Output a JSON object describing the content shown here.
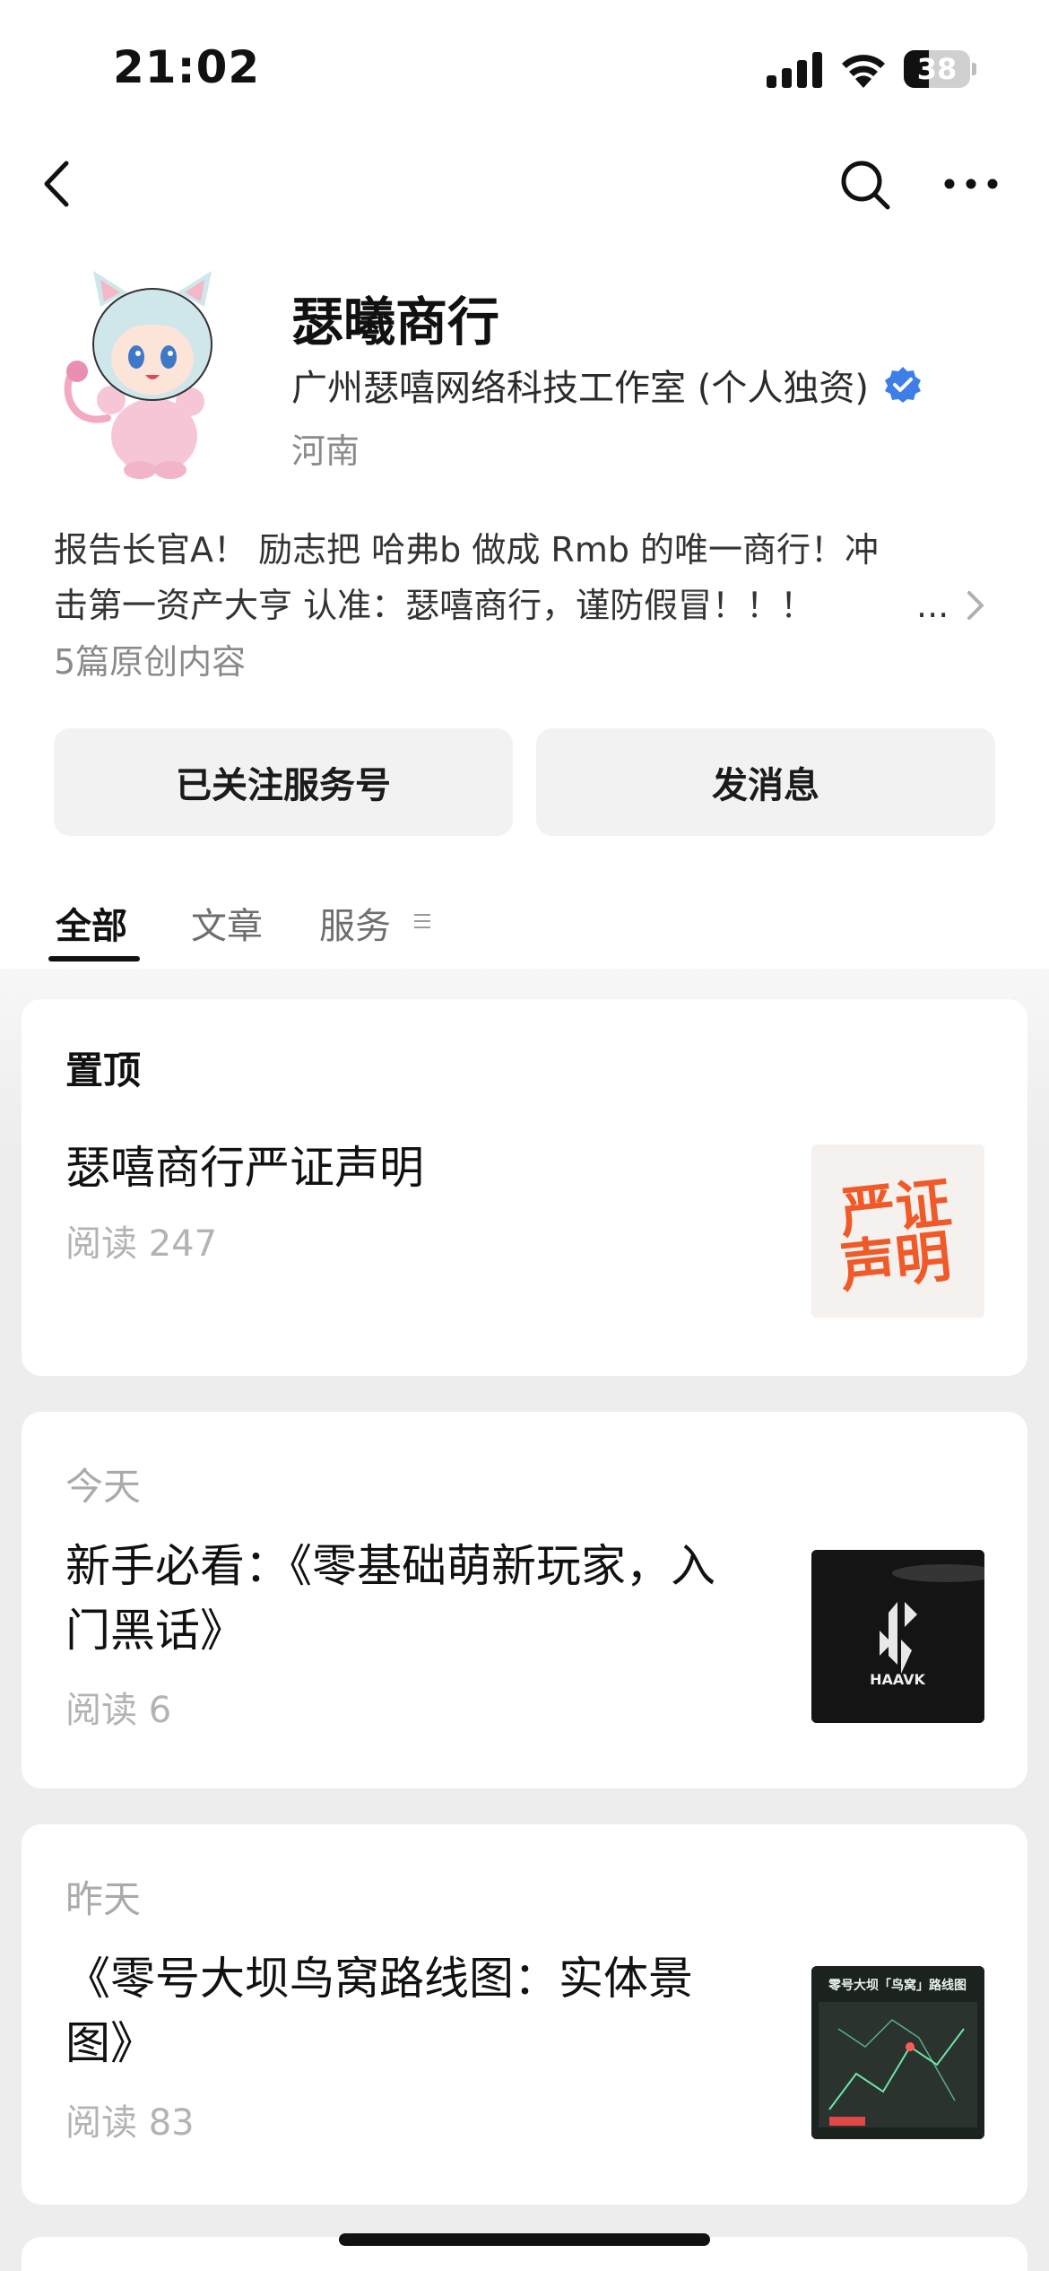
{
  "status_bar": {
    "time": "21:02",
    "battery_level": "38"
  },
  "profile": {
    "name": "瑟曦商行",
    "company": "广州瑟嘻网络科技工作室 (个人独资)",
    "region": "河南",
    "description_line1": "报告长官A！ 励志把 哈弗b 做成 Rmb 的唯一商行！冲",
    "description_line2": "击第一资产大亨 认准：瑟嘻商行，谨防假冒！！！",
    "ellipsis": "...",
    "original_count": "5篇原创内容"
  },
  "actions": {
    "follow_label": "已关注服务号",
    "message_label": "发消息"
  },
  "tabs": [
    {
      "label": "全部",
      "active": true
    },
    {
      "label": "文章",
      "active": false
    },
    {
      "label": "服务",
      "active": false
    }
  ],
  "cards": [
    {
      "header": "置顶",
      "title_lines": [
        "瑟嘻商行严证声明"
      ],
      "reads": "阅读 247",
      "thumb_text": "严证声明"
    },
    {
      "header": "今天",
      "title_lines": [
        "新手必看：《零基础萌新玩家，入",
        "门黑话》"
      ],
      "reads": "阅读 6",
      "thumb_text": "HAAVK"
    },
    {
      "header": "昨天",
      "title_lines": [
        "《零号大坝鸟窝路线图：实体景",
        "图》"
      ],
      "reads": "阅读 83",
      "thumb_text": "零号大坝「鸟窝」路线图"
    }
  ],
  "colors": {
    "accent_blue": "#3d7ee8",
    "background": "#ededed",
    "thumb1_orange": "#f05a28"
  }
}
